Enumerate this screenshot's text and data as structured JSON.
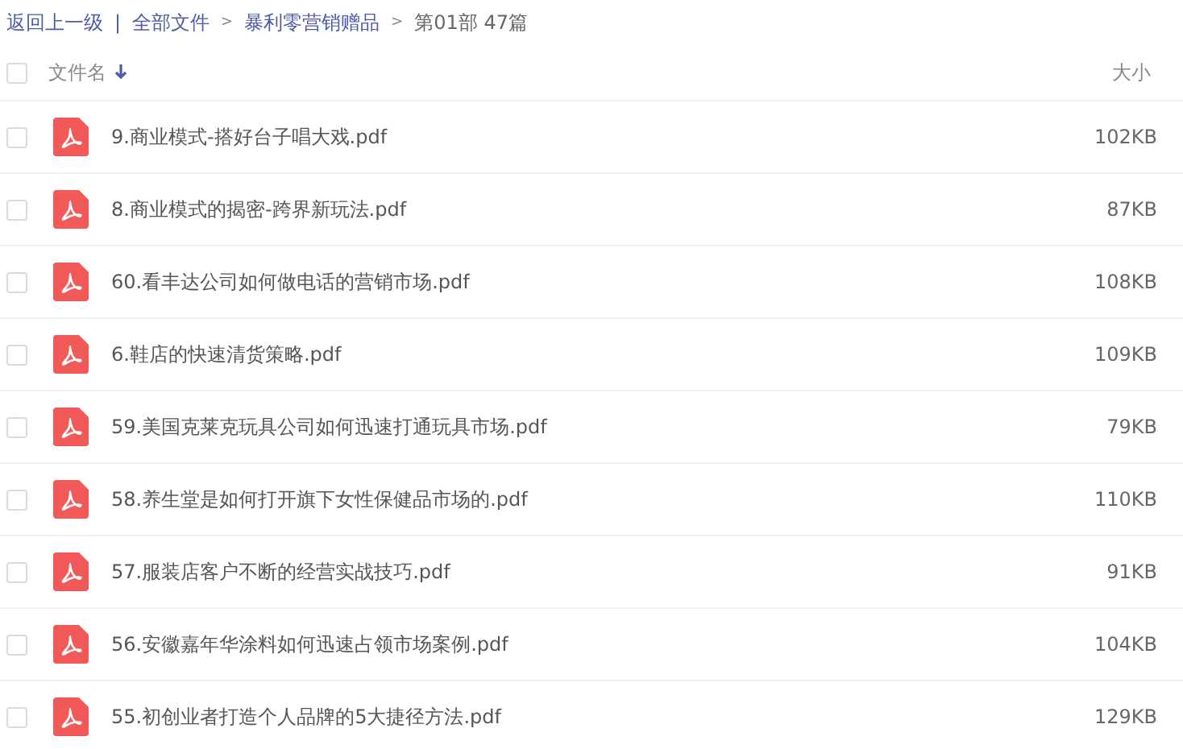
{
  "breadcrumb": {
    "links": [
      "返回上一级",
      "全部文件",
      "暴利零营销赠品"
    ],
    "divider": "|",
    "separators": [
      ">",
      ">"
    ],
    "current": "第01部 47篇"
  },
  "table": {
    "select_all": {
      "checked": false
    },
    "columns": [
      "文件名",
      "大小"
    ],
    "rows": [
      {
        "name": "9.商业模式-搭好台子唱大戏.pdf",
        "size": "102KB",
        "checked": false
      },
      {
        "name": "8.商业模式的揭密-跨界新玩法.pdf",
        "size": "87KB",
        "checked": false
      },
      {
        "name": "60.看丰达公司如何做电话的营销市场.pdf",
        "size": "108KB",
        "checked": false
      },
      {
        "name": "6.鞋店的快速清货策略.pdf",
        "size": "109KB",
        "checked": false
      },
      {
        "name": "59.美国克莱克玩具公司如何迅速打通玩具市场.pdf",
        "size": "79KB",
        "checked": false
      },
      {
        "name": "58.养生堂是如何打开旗下女性保健品市场的.pdf",
        "size": "110KB",
        "checked": false
      },
      {
        "name": "57.服装店客户不断的经营实战技巧.pdf",
        "size": "91KB",
        "checked": false
      },
      {
        "name": "56.安徽嘉年华涂料如何迅速占领市场案例.pdf",
        "size": "104KB",
        "checked": false
      },
      {
        "name": "55.初创业者打造个人品牌的5大捷径方法.pdf",
        "size": "129KB",
        "checked": false
      }
    ]
  }
}
